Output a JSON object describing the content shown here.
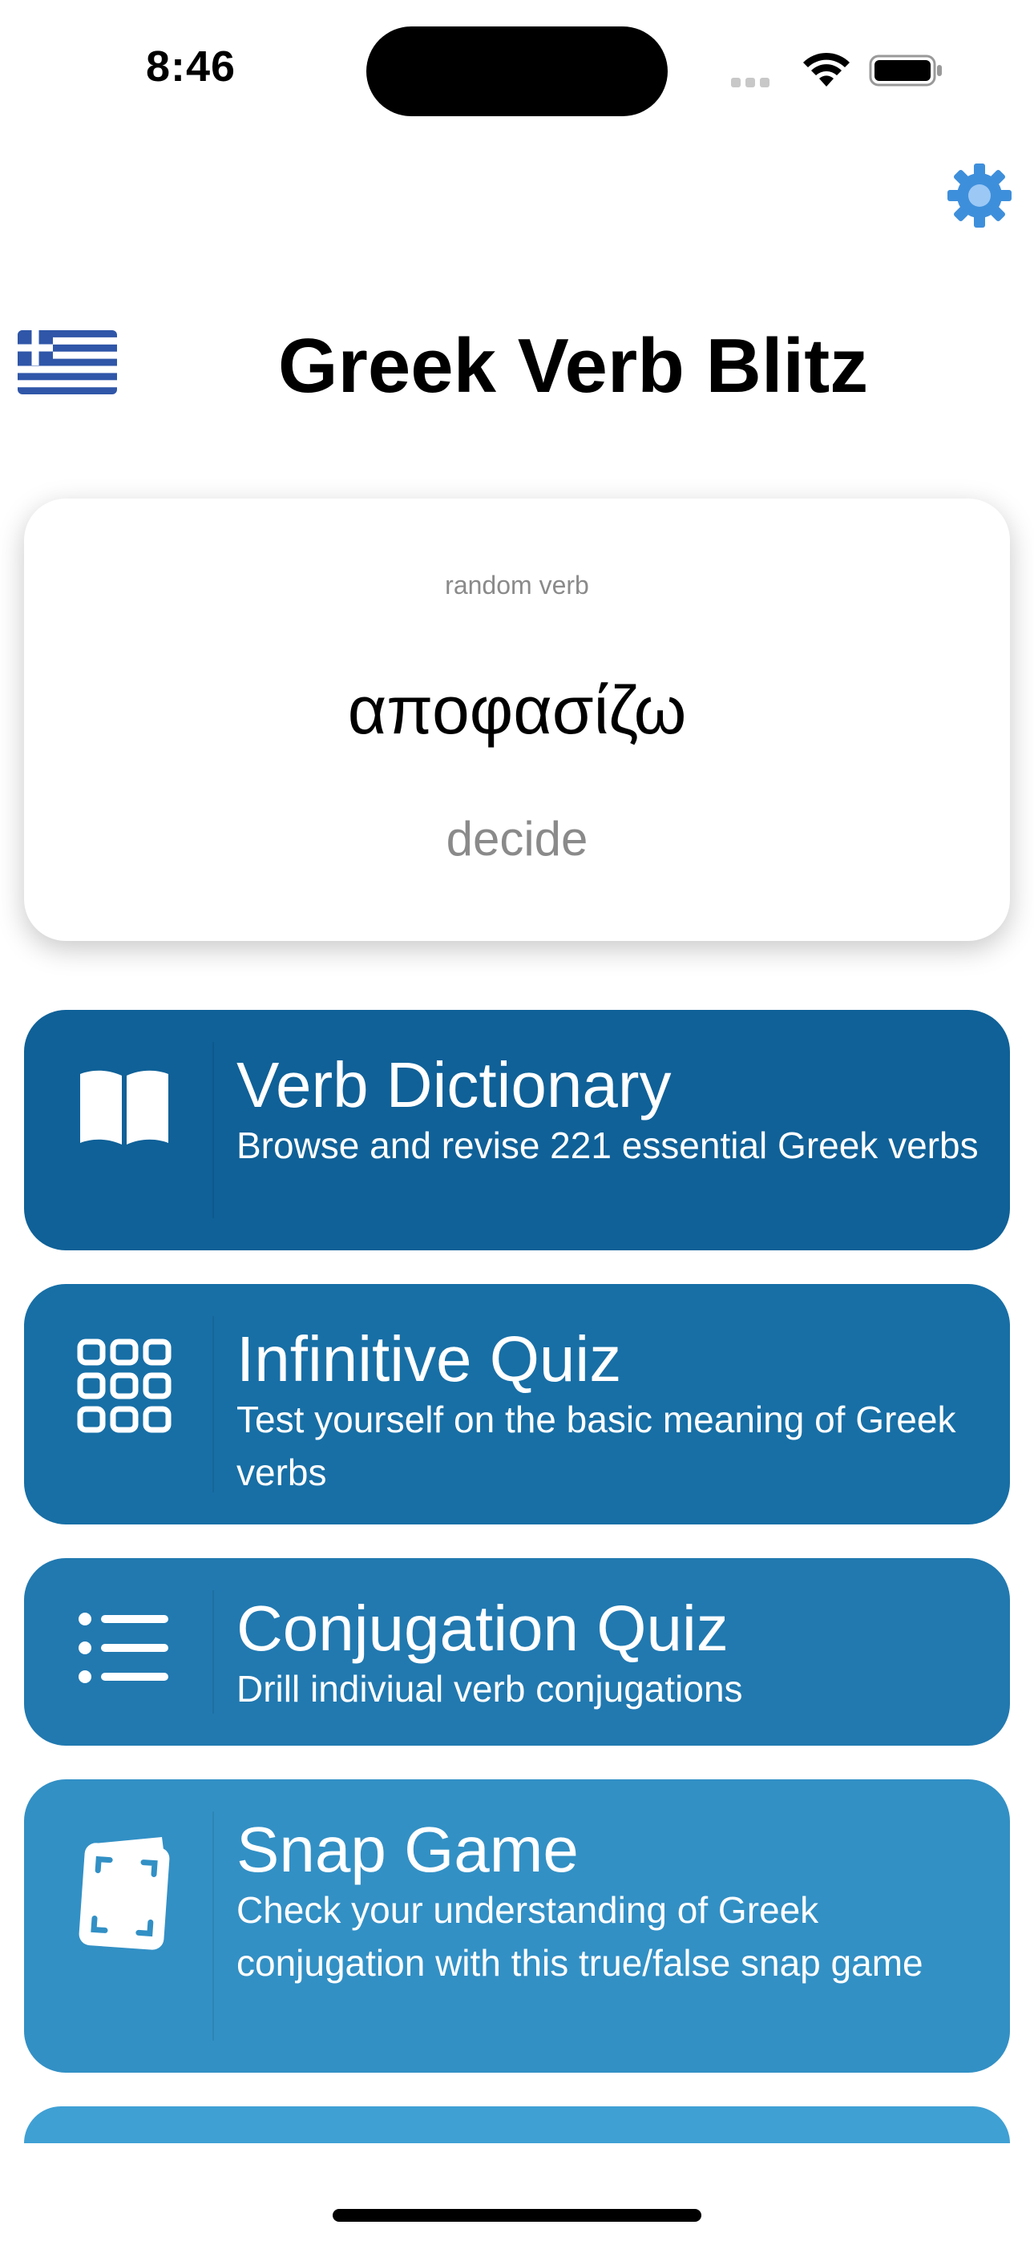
{
  "status_bar": {
    "time": "8:46"
  },
  "header": {
    "title": "Greek Verb Blitz",
    "settings_icon": "gear-icon",
    "flag_icon": "greek-flag-icon"
  },
  "random_card": {
    "caption": "random verb",
    "verb": "αποφασίζω",
    "meaning": "decide"
  },
  "menu": [
    {
      "title": "Verb Dictionary",
      "description": "Browse and revise 221 essential Greek verbs",
      "icon": "book-icon",
      "color": "#0F6198"
    },
    {
      "title": "Infinitive Quiz",
      "description": "Test yourself on the basic meaning of Greek verbs",
      "icon": "grid-icon",
      "color": "#176FA6"
    },
    {
      "title": "Conjugation Quiz",
      "description": "Drill indiviual verb conjugations",
      "icon": "list-icon",
      "color": "#2179B0"
    },
    {
      "title": "Snap Game",
      "description": "Check your understanding of Greek conjugation with this true/false snap game",
      "icon": "cards-icon",
      "color": "#3290C5"
    }
  ],
  "colors": {
    "accent": "#3E8FDB",
    "partial_button": "#3FA0D4"
  }
}
